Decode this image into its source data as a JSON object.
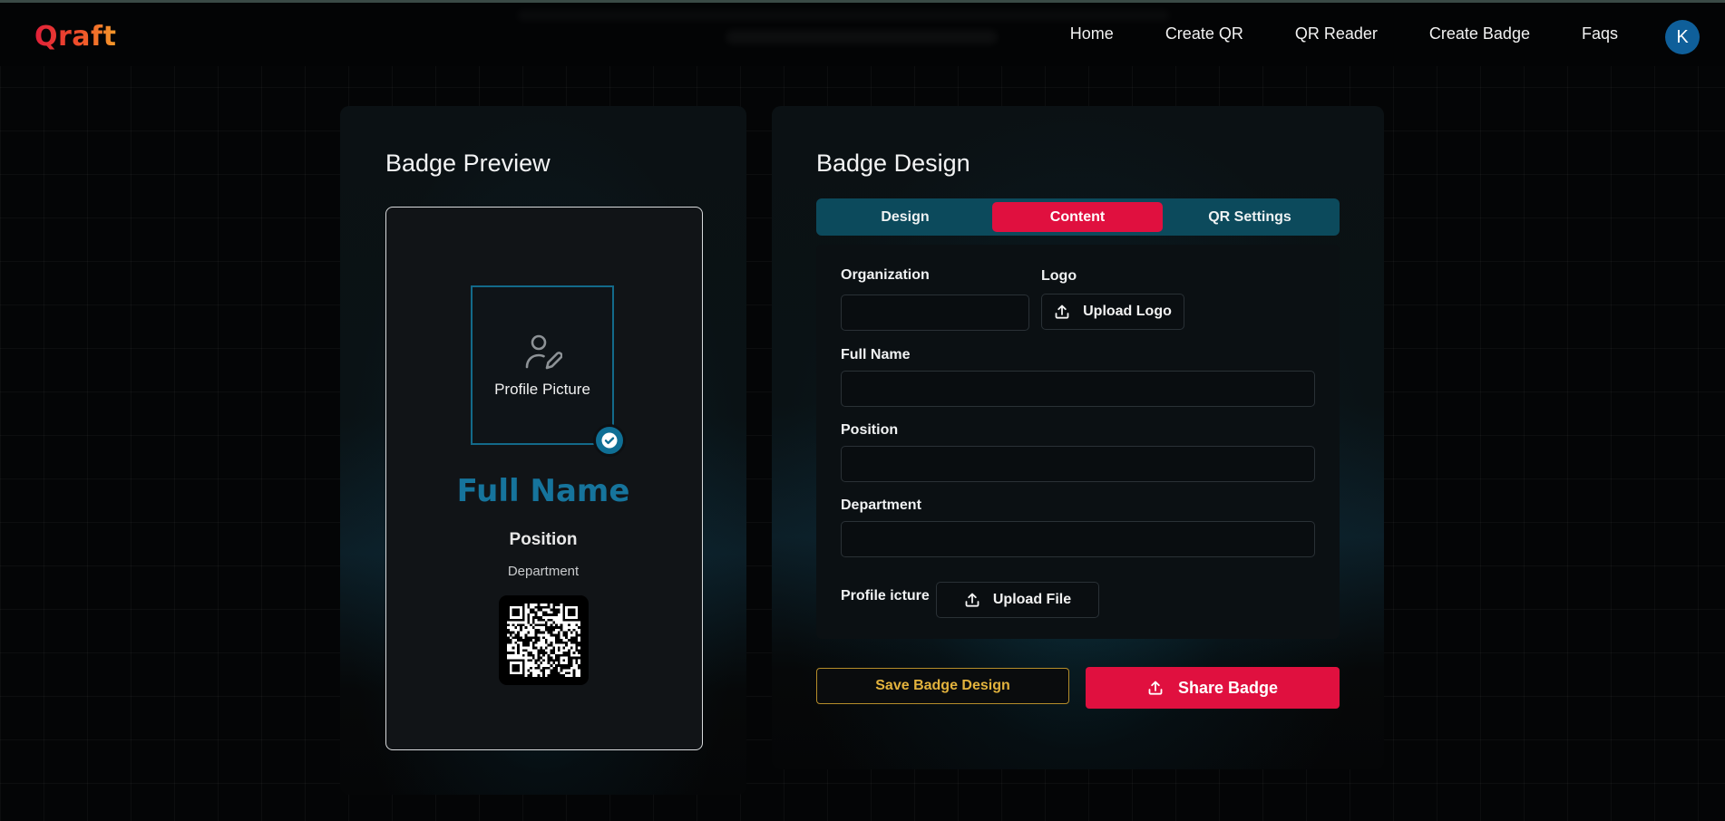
{
  "app": {
    "logo": "Qraft",
    "avatar_initial": "K"
  },
  "nav": {
    "items": [
      "Home",
      "Create QR",
      "QR Reader",
      "Create Badge",
      "Faqs"
    ]
  },
  "preview": {
    "title": "Badge Preview",
    "photo_label": "Profile Picture",
    "full_name": "Full Name",
    "position": "Position",
    "department": "Department"
  },
  "design": {
    "title": "Badge Design",
    "tabs": [
      {
        "label": "Design",
        "active": false
      },
      {
        "label": "Content",
        "active": true
      },
      {
        "label": "QR Settings",
        "active": false
      }
    ],
    "form": {
      "organization_label": "Organization",
      "organization_value": "",
      "logo_label": "Logo",
      "upload_logo_label": "Upload Logo",
      "full_name_label": "Full Name",
      "full_name_value": "",
      "position_label": "Position",
      "position_value": "",
      "department_label": "Department",
      "department_value": "",
      "profile_picture_label": "Profile icture",
      "upload_file_label": "Upload File"
    },
    "save_label": "Save Badge Design",
    "share_label": "Share Badge"
  },
  "colors": {
    "accent_red": "#e0103f",
    "accent_teal": "#16749c",
    "accent_gold": "#e3b33d"
  }
}
